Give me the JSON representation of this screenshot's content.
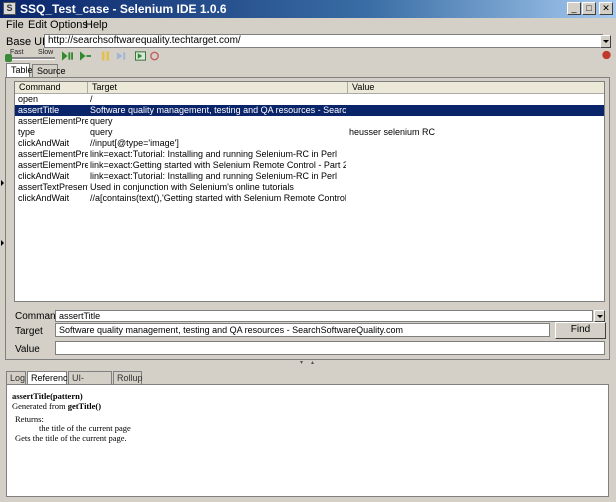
{
  "window": {
    "title": "SSQ_Test_case - Selenium IDE 1.0.6",
    "minimize_icon": "minimize-icon",
    "maximize_icon": "maximize-icon",
    "close_icon": "close-icon"
  },
  "menu": {
    "items": [
      "File",
      "Edit",
      "Options",
      "Help"
    ]
  },
  "base_url": {
    "label": "Base URL",
    "value": "http://searchsoftwarequality.techtarget.com/"
  },
  "toolbar": {
    "fast_label": "Fast",
    "slow_label": "Slow",
    "icons": [
      "play-all-icon",
      "play-current-icon",
      "pause-icon",
      "step-icon",
      "rollup-icon",
      "record-icon"
    ],
    "record_color": "#c0392b"
  },
  "editor_tabs": [
    "Table",
    "Source"
  ],
  "table": {
    "headers": [
      "Command",
      "Target",
      "Value"
    ],
    "rows": [
      {
        "command": "open",
        "target": "/",
        "value": ""
      },
      {
        "command": "assertTitle",
        "target": "Software quality management, testing and QA resources - SearchSoftwa...",
        "value": ""
      },
      {
        "command": "assertElementPre...",
        "target": "query",
        "value": ""
      },
      {
        "command": "type",
        "target": "query",
        "value": "heusser selenium RC"
      },
      {
        "command": "clickAndWait",
        "target": "//input[@type='image']",
        "value": ""
      },
      {
        "command": "assertElementPre...",
        "target": "link=exact:Tutorial: Installing and running Selenium-RC in Perl",
        "value": ""
      },
      {
        "command": "assertElementPre...",
        "target": "link=exact:Getting started with Selenium Remote Control - Part 2",
        "value": ""
      },
      {
        "command": "clickAndWait",
        "target": "link=exact:Tutorial: Installing and running Selenium-RC in Perl",
        "value": ""
      },
      {
        "command": "assertTextPresent",
        "target": "Used in conjunction with Selenium's online tutorials",
        "value": ""
      },
      {
        "command": "clickAndWait",
        "target": "//a[contains(text(),'Getting started with Selenium Remote Control  - Part...",
        "value": ""
      }
    ],
    "selected_index": 1,
    "selection_color": "#0a246a"
  },
  "command_field": {
    "label": "Command",
    "value": "assertTitle"
  },
  "target_field": {
    "label": "Target",
    "value": "Software quality management, testing and QA resources - SearchSoftwareQuality.com"
  },
  "value_field": {
    "label": "Value",
    "value": ""
  },
  "find_button": "Find",
  "bottom_tabs": [
    "Log",
    "Reference",
    "UI-Element",
    "Rollup"
  ],
  "reference": {
    "signature": "assertTitle(pattern)",
    "generated_prefix": "Generated from ",
    "generated_from": "getTitle()",
    "returns_label": "Returns:",
    "returns_text": "the title of the current page",
    "description": "Gets the title of the current page."
  }
}
